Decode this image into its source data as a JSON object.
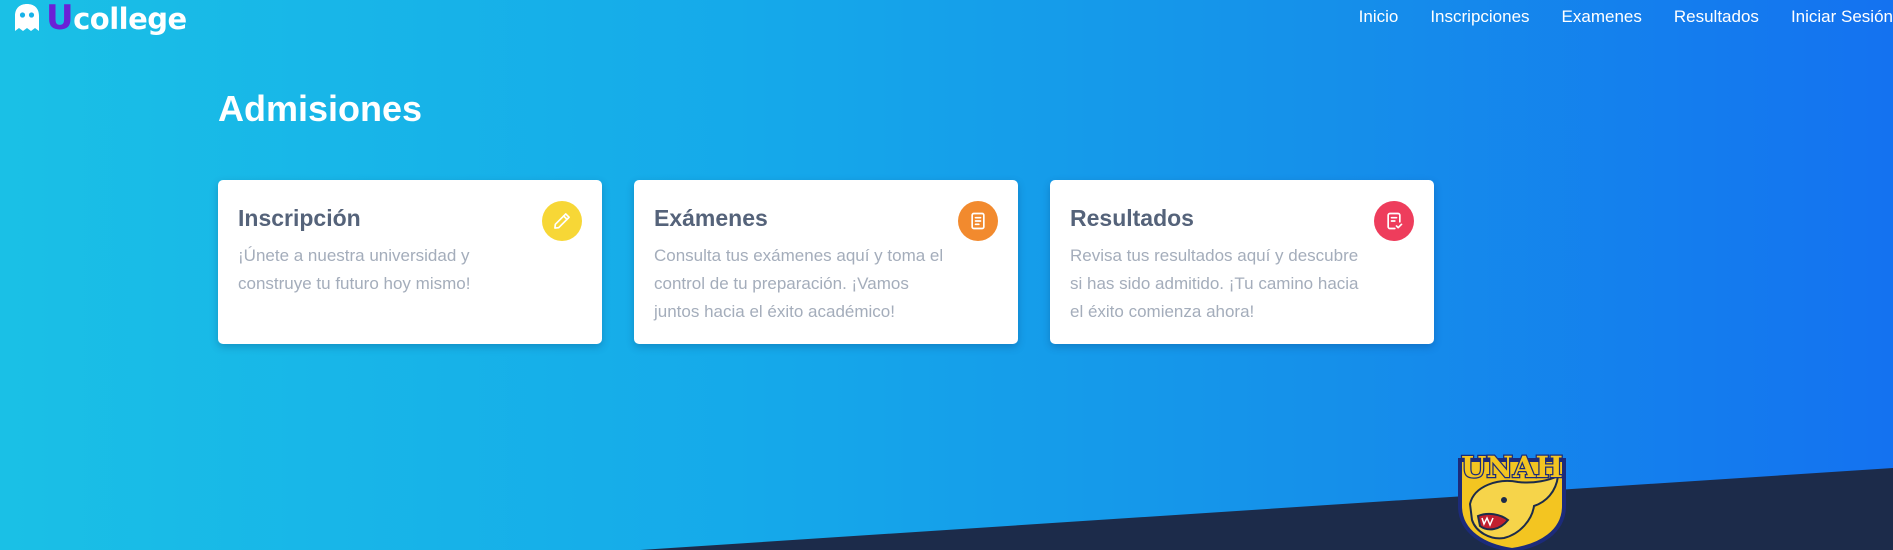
{
  "brand": {
    "u_letter": "U",
    "rest": "college",
    "accent_color": "#6b21d6"
  },
  "nav": {
    "items": [
      {
        "label": "Inicio"
      },
      {
        "label": "Inscripciones"
      },
      {
        "label": "Examenes"
      },
      {
        "label": "Resultados"
      },
      {
        "label": "Iniciar Sesión"
      }
    ]
  },
  "main": {
    "title": "Admisiones",
    "cards": [
      {
        "title": "Inscripción",
        "text": "¡Únete a nuestra universidad y construye tu futuro hoy mismo!",
        "icon": "pencil-icon",
        "icon_color": "#f7d736"
      },
      {
        "title": "Exámenes",
        "text": "Consulta tus exámenes aquí y toma el control de tu preparación. ¡Vamos juntos hacia el éxito académico!",
        "icon": "document-icon",
        "icon_color": "#f28a2e"
      },
      {
        "title": "Resultados",
        "text": "Revisa tus resultados aquí y descubre si has sido admitido. ¡Tu camino hacia el éxito comienza ahora!",
        "icon": "clipboard-check-icon",
        "icon_color": "#ee3d5c"
      }
    ]
  },
  "mascot": {
    "text": "UNAH",
    "icon": "puma-mascot-logo"
  },
  "colors": {
    "bottom_band": "#1c2b4a"
  }
}
